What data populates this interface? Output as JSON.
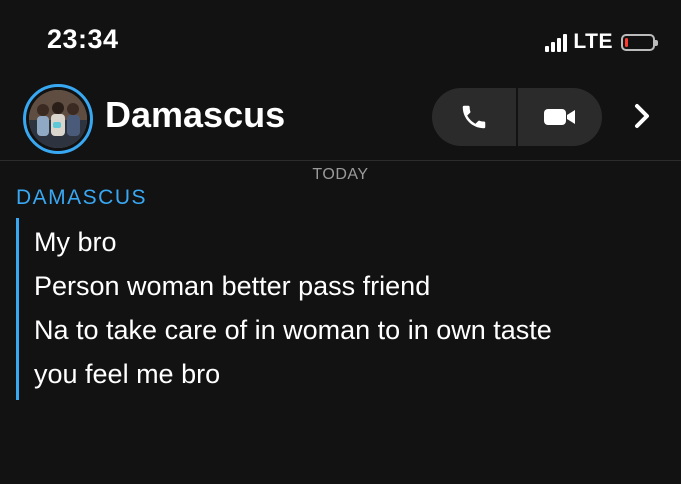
{
  "status_bar": {
    "time": "23:34",
    "network": "LTE",
    "battery_level": 0.12,
    "battery_color": "#ff3b30"
  },
  "header": {
    "contact_name": "Damascus",
    "avatar": "contact-photo",
    "ring_color": "#39a8f3",
    "icons": [
      "phone-icon",
      "video-camera-icon",
      "chevron-right-icon"
    ]
  },
  "chat": {
    "day_label": "TODAY",
    "sender": "DAMASCUS",
    "messages": [
      "My bro",
      "Person woman better pass friend",
      "Na to take care of in woman to in own taste",
      "you feel me bro"
    ]
  },
  "colors": {
    "background": "#121212",
    "accent": "#39a8f3",
    "button_bg": "#2b2b2b"
  }
}
